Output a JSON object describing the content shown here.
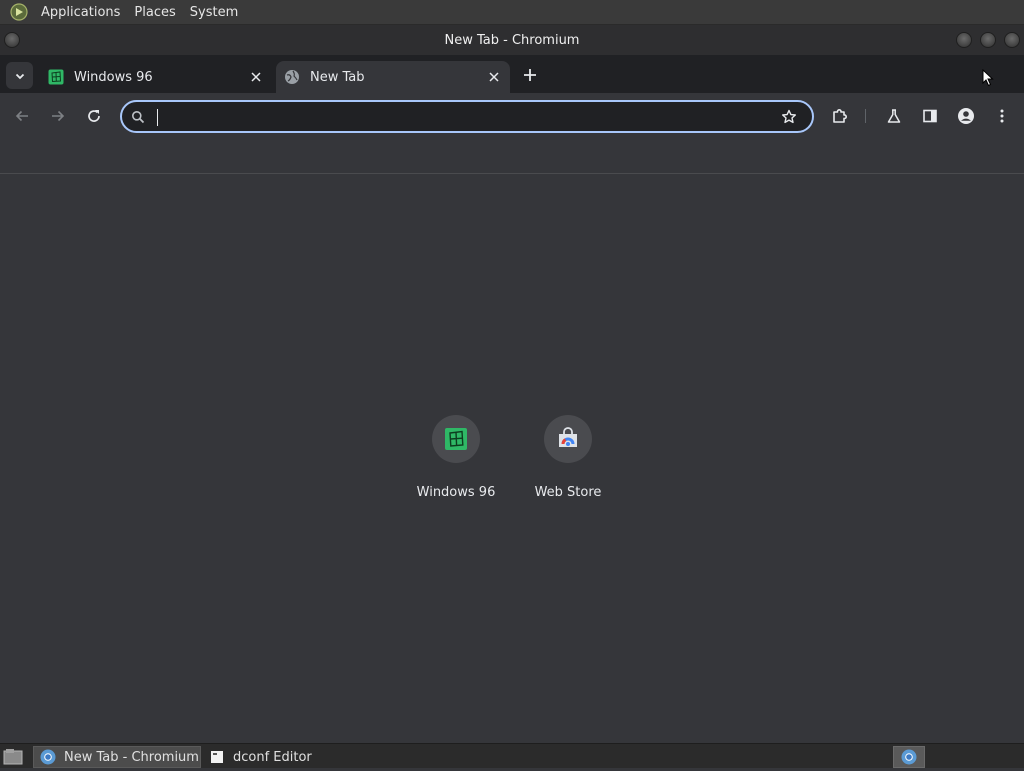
{
  "top_panel": {
    "menus": [
      "Applications",
      "Places",
      "System"
    ]
  },
  "window": {
    "title": "New Tab - Chromium"
  },
  "tabs": [
    {
      "title": "Windows 96",
      "active": false,
      "favicon": "windows96-icon"
    },
    {
      "title": "New Tab",
      "active": true,
      "favicon": "globe-icon"
    }
  ],
  "omnibox": {
    "value": "",
    "placeholder": ""
  },
  "shortcuts": [
    {
      "label": "Windows 96",
      "icon": "windows96-icon"
    },
    {
      "label": "Web Store",
      "icon": "webstore-icon"
    }
  ],
  "taskbar": {
    "tasks": [
      {
        "label": "New Tab - Chromium",
        "active": true,
        "icon": "chromium-icon"
      },
      {
        "label": "dconf Editor",
        "active": false,
        "icon": "dconf-icon"
      }
    ]
  },
  "colors": {
    "page_background": "#35363a",
    "tabstrip_background": "#202124",
    "omnibox_focus_ring": "#a8c7fa",
    "windows96_green": "#2fb866"
  }
}
